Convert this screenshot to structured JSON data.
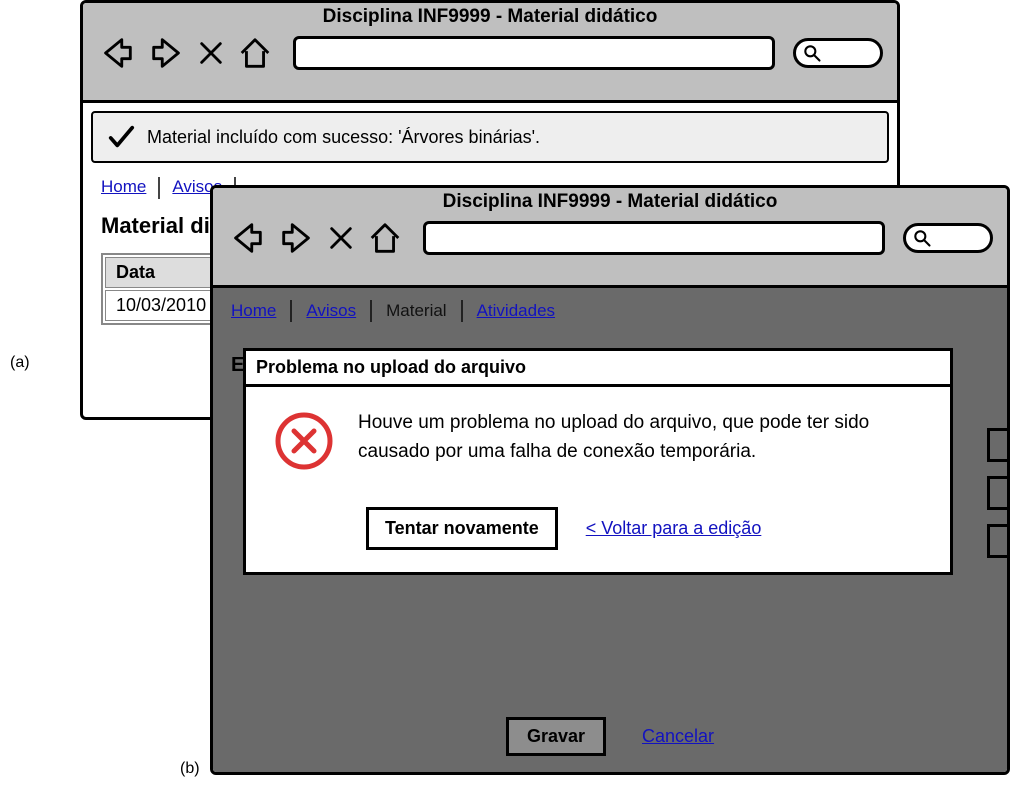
{
  "labels": {
    "a": "(a)",
    "b": "(b)"
  },
  "window_a": {
    "title": "Disciplina INF9999 - Material didático",
    "success_message": "Material incluído com sucesso: 'Árvores binárias'.",
    "tabs": {
      "home": "Home",
      "avisos": "Avisos"
    },
    "heading": "Material didático",
    "table": {
      "header_data": "Data",
      "row1_date": "10/03/2010"
    }
  },
  "window_b": {
    "title": "Disciplina INF9999 - Material didático",
    "tabs": {
      "home": "Home",
      "avisos": "Avisos",
      "material": "Material",
      "atividades": "Atividades"
    },
    "hint_char": "E",
    "dialog": {
      "title": "Problema no upload do arquivo",
      "message": "Houve um problema no upload do arquivo, que pode ter sido causado por uma falha de conexão temporária.",
      "retry": "Tentar novamente",
      "back": "< Voltar para a edição"
    },
    "bottom": {
      "save": "Gravar",
      "cancel": "Cancelar"
    }
  }
}
